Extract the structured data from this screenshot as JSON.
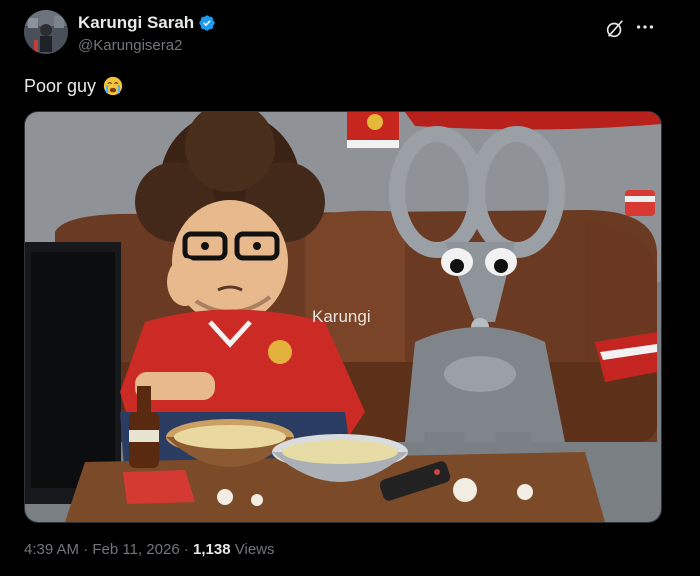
{
  "tweet": {
    "display_name": "Karungi Sarah",
    "handle": "@Karungisera2",
    "verified_icon": "verified-badge-icon",
    "text": "Poor guy",
    "emoji": "crying-face-emoji",
    "image_watermark": "Karungi",
    "time": "4:39 AM",
    "date": "Feb 11, 2026",
    "views_count": "1,138",
    "views_label": "Views",
    "separator": "·"
  },
  "icons": {
    "grok": "grok-icon",
    "more": "more-options-icon"
  },
  "colors": {
    "background": "#000000",
    "text_primary": "#e7e9ea",
    "text_secondary": "#71767b",
    "verified": "#1d9bf0"
  }
}
